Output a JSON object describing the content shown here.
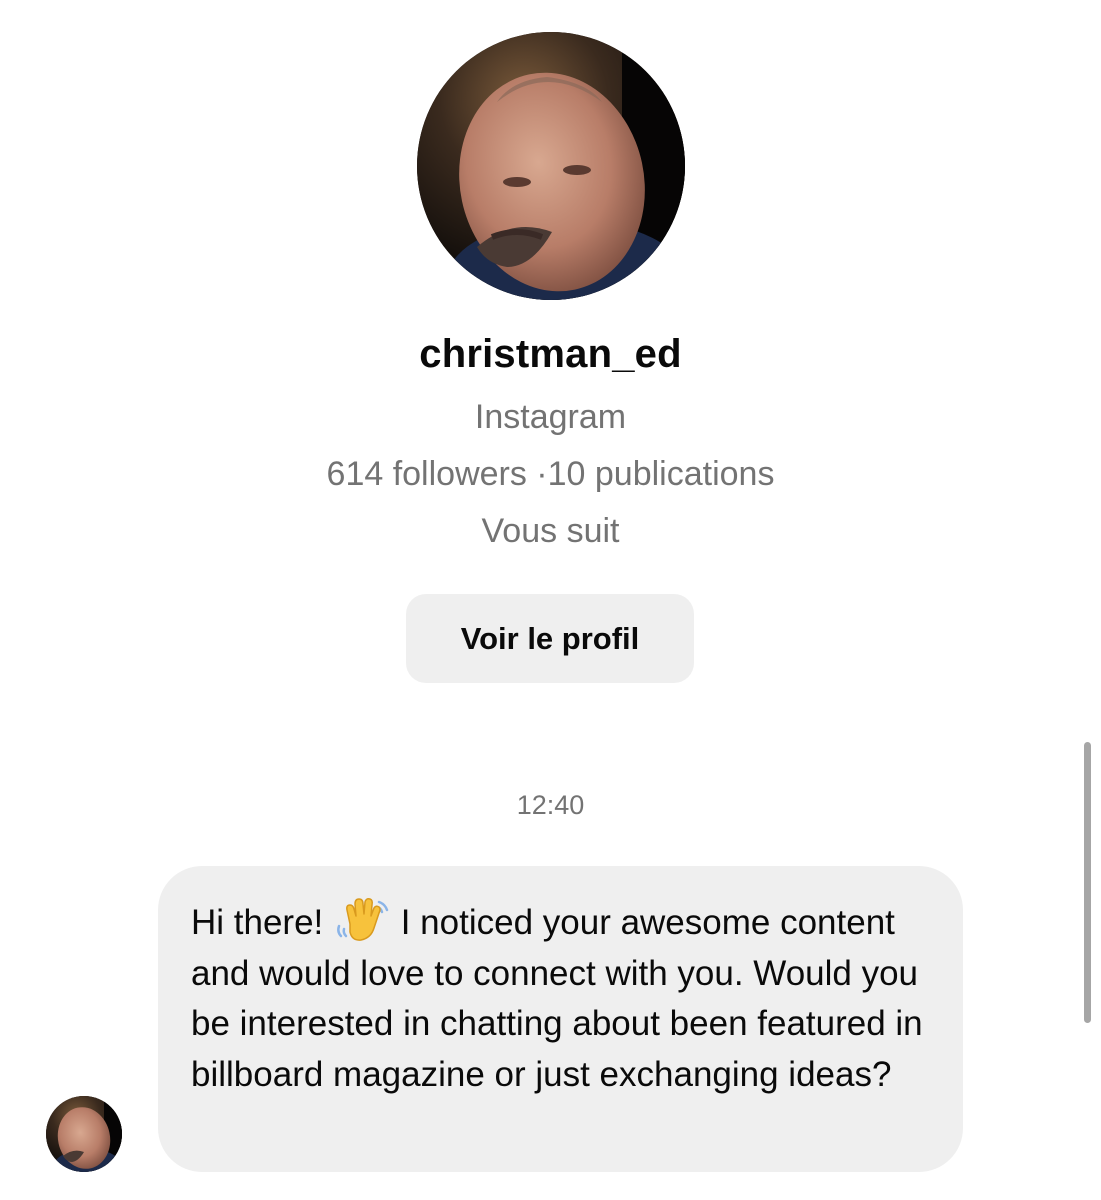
{
  "profile": {
    "username": "christman_ed",
    "platform": "Instagram",
    "stats": "614 followers ·10 publications",
    "follow_status": "Vous suit",
    "view_profile_label": "Voir le profil"
  },
  "thread": {
    "timestamp": "12:40",
    "message": {
      "text_before_emoji": "Hi there! ",
      "emoji": "waving-hand",
      "text_after_emoji": " I noticed your awesome content and would love to connect with you. Would you be interested in chatting about been featured in billboard magazine or just exchanging ideas?"
    }
  },
  "colors": {
    "secondary_text": "#737373",
    "bubble_bg": "#efefef",
    "button_bg": "#efefef",
    "primary_text": "#0a0a0a"
  },
  "icons": {
    "profile_avatar": "profile-photo-icon",
    "sender_avatar": "sender-avatar-icon",
    "emoji": "waving-hand-emoji-icon"
  }
}
